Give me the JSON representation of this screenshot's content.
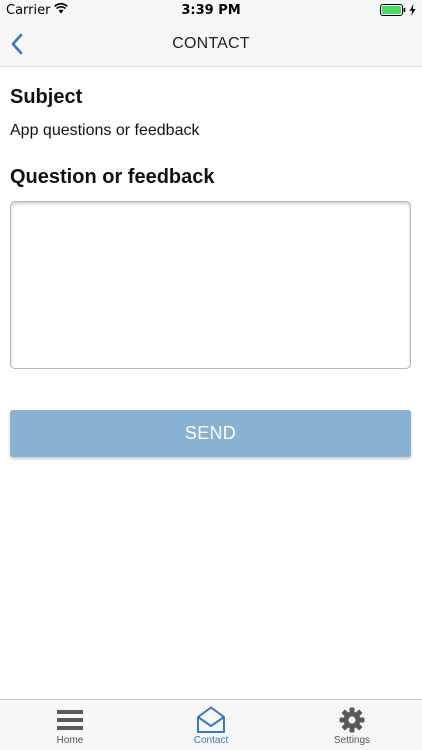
{
  "status_bar": {
    "carrier": "Carrier",
    "time": "3:39 PM",
    "icons": [
      "wifi-icon",
      "battery-icon",
      "charging-bolt-icon"
    ]
  },
  "nav": {
    "title": "CONTACT",
    "back_icon": "chevron-left-icon"
  },
  "form": {
    "subject_label": "Subject",
    "subject_value": "App questions or feedback",
    "feedback_label": "Question or feedback",
    "feedback_value": "",
    "send_label": "SEND"
  },
  "tabs": [
    {
      "label": "Home",
      "icon": "hamburger-menu-icon",
      "active": false
    },
    {
      "label": "Contact",
      "icon": "envelope-open-icon",
      "active": true
    },
    {
      "label": "Settings",
      "icon": "gear-icon",
      "active": false
    }
  ],
  "colors": {
    "accent": "#3a78c2",
    "send_button": "#88b1d2",
    "battery": "#4cd964"
  }
}
